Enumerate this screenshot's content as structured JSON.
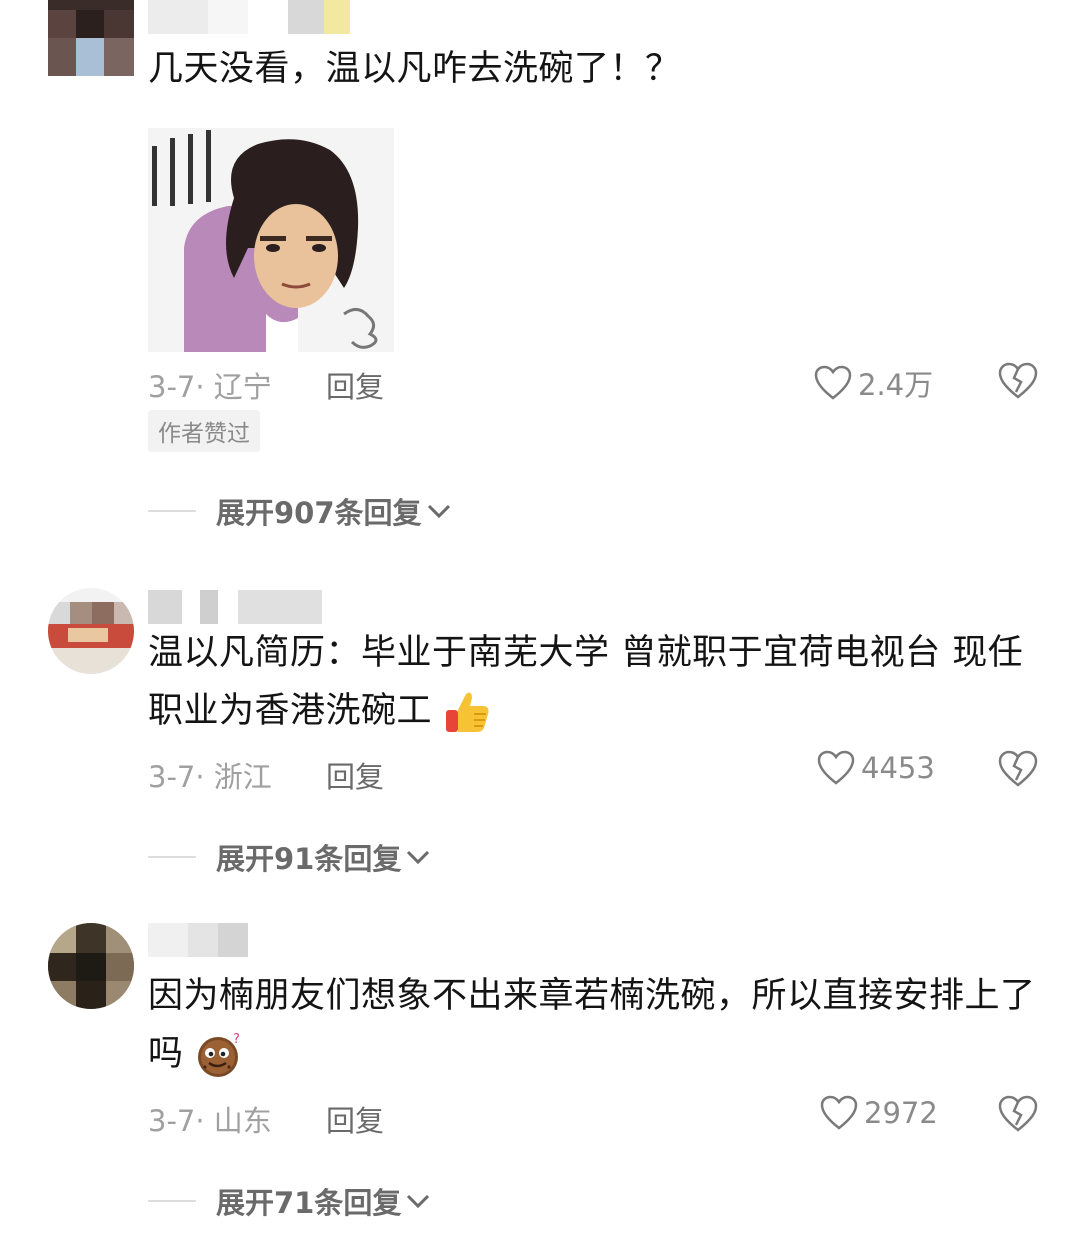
{
  "comments": [
    {
      "text": "几天没看，温以凡咋去洗碗了！？",
      "date_location": "3-7· 辽宁",
      "reply_label": "回复",
      "likes": "2.4万",
      "author_badge": "作者赞过",
      "expand_label": "展开907条回复"
    },
    {
      "text": "温以凡简历：毕业于南芜大学 曾就职于宜荷电视台 现任职业为香港洗碗工",
      "date_location": "3-7· 浙江",
      "reply_label": "回复",
      "likes": "4453",
      "expand_label": "展开91条回复"
    },
    {
      "text": "因为楠朋友们想象不出来章若楠洗碗，所以直接安排上了吗",
      "date_location": "3-7· 山东",
      "reply_label": "回复",
      "likes": "2972",
      "expand_label": "展开71条回复"
    }
  ],
  "icons": {
    "like": "heart-outline-icon",
    "dislike": "broken-heart-icon",
    "expand": "chevron-down-icon",
    "thumbs_up": "thumbs-up-emoji",
    "cookie": "cookie-face-emoji"
  },
  "colors": {
    "text": "#141414",
    "meta": "#a0a0a0",
    "secondary": "#6a6a6a"
  }
}
